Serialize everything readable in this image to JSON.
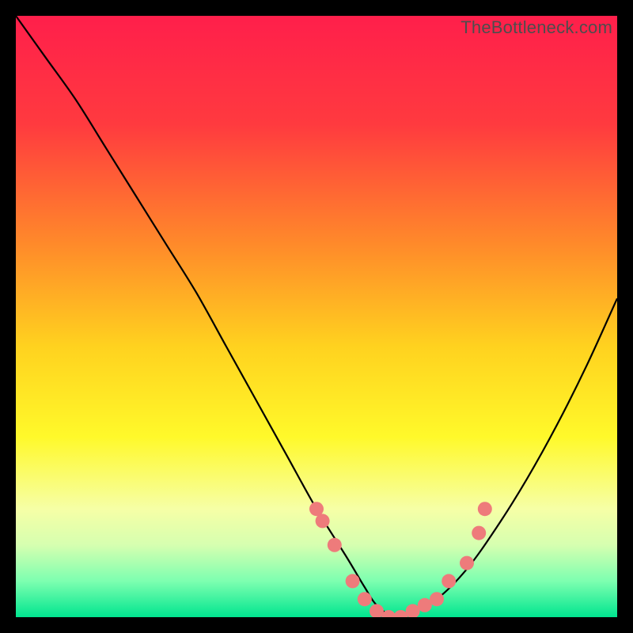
{
  "watermark": "TheBottleneck.com",
  "chart_data": {
    "type": "line",
    "title": "",
    "xlabel": "",
    "ylabel": "",
    "xlim": [
      0,
      100
    ],
    "ylim": [
      0,
      100
    ],
    "grid": false,
    "legend": false,
    "background": {
      "type": "vertical-gradient",
      "stops": [
        {
          "pos": 0.0,
          "color": "#ff1f4b"
        },
        {
          "pos": 0.18,
          "color": "#ff3a3f"
        },
        {
          "pos": 0.38,
          "color": "#ff8a2a"
        },
        {
          "pos": 0.55,
          "color": "#ffd21f"
        },
        {
          "pos": 0.7,
          "color": "#fff92a"
        },
        {
          "pos": 0.82,
          "color": "#f6ffa6"
        },
        {
          "pos": 0.88,
          "color": "#d6ffb0"
        },
        {
          "pos": 0.94,
          "color": "#7dffb0"
        },
        {
          "pos": 1.0,
          "color": "#00e58f"
        }
      ]
    },
    "series": [
      {
        "name": "bottleneck-curve",
        "color": "#000000",
        "x": [
          0,
          5,
          10,
          15,
          20,
          25,
          30,
          35,
          40,
          45,
          50,
          55,
          58,
          60,
          63,
          66,
          70,
          75,
          80,
          85,
          90,
          95,
          100
        ],
        "y": [
          100,
          93,
          86,
          78,
          70,
          62,
          54,
          45,
          36,
          27,
          18,
          10,
          5,
          2,
          0,
          1,
          3,
          8,
          15,
          23,
          32,
          42,
          53
        ]
      }
    ],
    "markers": {
      "name": "highlighted-points",
      "color": "#ee7b7b",
      "radius_px": 9,
      "points": [
        {
          "x": 50,
          "y": 18
        },
        {
          "x": 51,
          "y": 16
        },
        {
          "x": 53,
          "y": 12
        },
        {
          "x": 56,
          "y": 6
        },
        {
          "x": 58,
          "y": 3
        },
        {
          "x": 60,
          "y": 1
        },
        {
          "x": 62,
          "y": 0
        },
        {
          "x": 64,
          "y": 0
        },
        {
          "x": 66,
          "y": 1
        },
        {
          "x": 68,
          "y": 2
        },
        {
          "x": 70,
          "y": 3
        },
        {
          "x": 72,
          "y": 6
        },
        {
          "x": 75,
          "y": 9
        },
        {
          "x": 77,
          "y": 14
        },
        {
          "x": 78,
          "y": 18
        }
      ]
    }
  }
}
